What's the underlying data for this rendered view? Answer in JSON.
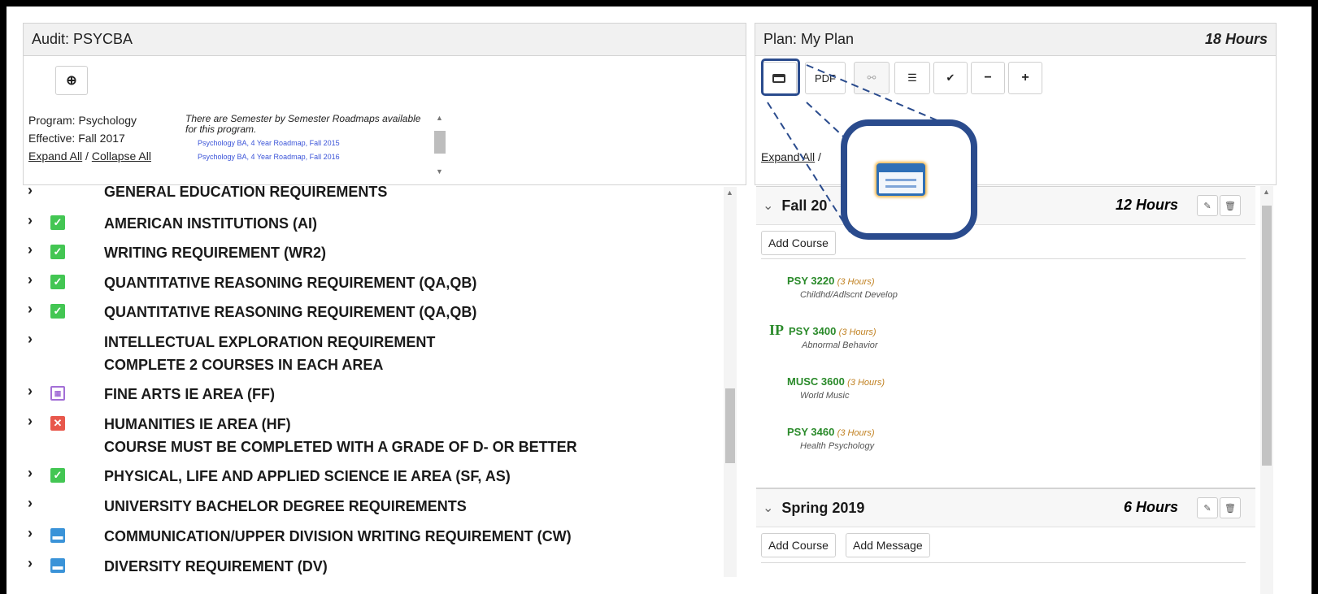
{
  "audit": {
    "title": "Audit: PSYCBA",
    "program_label": "Program: Psychology",
    "effective_label": "Effective: Fall 2017",
    "expand_all": "Expand All",
    "separator": " / ",
    "collapse_all": "Collapse All",
    "roadmap_note": "There are Semester by Semester Roadmaps available for this program.",
    "roadmaps": [
      "Psychology BA, 4 Year Roadmap, Fall 2015",
      "Psychology BA, 4 Year Roadmap, Fall 2016"
    ],
    "requirements": [
      {
        "label": "GENERAL EDUCATION REQUIREMENTS",
        "status": "none"
      },
      {
        "label": "AMERICAN INSTITUTIONS (AI)",
        "status": "complete"
      },
      {
        "label": "WRITING REQUIREMENT (WR2)",
        "status": "complete"
      },
      {
        "label": "QUANTITATIVE REASONING REQUIREMENT (QA,QB)",
        "status": "complete"
      },
      {
        "label": "QUANTITATIVE REASONING REQUIREMENT (QA,QB)",
        "status": "complete"
      },
      {
        "label": "INTELLECTUAL EXPLORATION REQUIREMENT",
        "sub": "COMPLETE 2 COURSES IN EACH AREA",
        "status": "none"
      },
      {
        "label": "FINE ARTS IE AREA (FF)",
        "status": "in-progress"
      },
      {
        "label": "HUMANITIES IE AREA (HF)",
        "sub": "COURSE MUST BE COMPLETED WITH A GRADE OF D- OR BETTER",
        "status": "failed"
      },
      {
        "label": "PHYSICAL, LIFE AND APPLIED SCIENCE IE AREA (SF, AS)",
        "status": "complete"
      },
      {
        "label": "UNIVERSITY BACHELOR DEGREE REQUIREMENTS",
        "status": "none"
      },
      {
        "label": "COMMUNICATION/UPPER DIVISION WRITING REQUIREMENT (CW)",
        "status": "planned"
      },
      {
        "label": "DIVERSITY REQUIREMENT (DV)",
        "status": "planned"
      }
    ]
  },
  "plan": {
    "title": "Plan: My Plan",
    "total_hours": "18 Hours",
    "toolbar": {
      "pdf_label": "PDF",
      "minus": "−",
      "plus": "+",
      "check": "✔"
    },
    "expand_all": "Expand All",
    "expand_sep": " /",
    "terms": [
      {
        "name": "Fall 20",
        "hours": "12 Hours",
        "add_course": "Add Course",
        "courses": [
          {
            "code": "PSY 3220",
            "hours": "(3 Hours)",
            "title": "Childhd/Adlscnt Develop",
            "ip": ""
          },
          {
            "code": "PSY 3400",
            "hours": "(3 Hours)",
            "title": "Abnormal Behavior",
            "ip": "IP"
          },
          {
            "code": "MUSC 3600",
            "hours": "(3 Hours)",
            "title": "World Music",
            "ip": ""
          },
          {
            "code": "PSY 3460",
            "hours": "(3 Hours)",
            "title": "Health Psychology",
            "ip": ""
          }
        ]
      },
      {
        "name": "Spring 2019",
        "hours": "6 Hours",
        "add_course": "Add Course",
        "add_message": "Add Message"
      }
    ]
  },
  "colors": {
    "callout": "#2a4b8d",
    "complete": "#43c653",
    "failed": "#e8584c",
    "planned": "#3a93d8",
    "in_progress": "#a36fd6",
    "course_code": "#2a8a2a"
  }
}
